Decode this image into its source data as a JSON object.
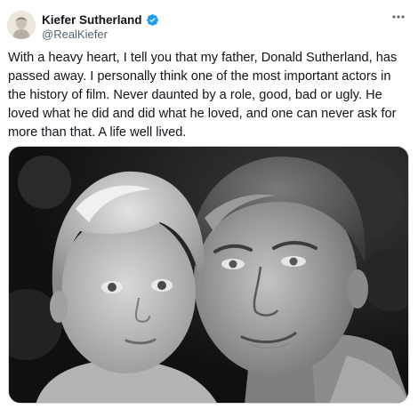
{
  "post": {
    "author": {
      "display_name": "Kiefer Sutherland",
      "handle": "@RealKiefer",
      "verified": true,
      "avatar_icon": "avatar-photo"
    },
    "more_icon": "more-horizontal-icon",
    "text": "With a heavy heart, I tell you that my father, Donald Sutherland, has passed away. I personally think one of the most important actors in the history of film. Never daunted by a role, good, bad or ugly. He loved what he did and did what he loved, and one can never ask for more than that. A life well lived.",
    "media": {
      "type": "photo",
      "style": "black-and-white"
    }
  },
  "colors": {
    "text_primary": "#0f1419",
    "text_secondary": "#536471",
    "verified_blue": "#1d9bf0",
    "border": "#cfd9de"
  }
}
